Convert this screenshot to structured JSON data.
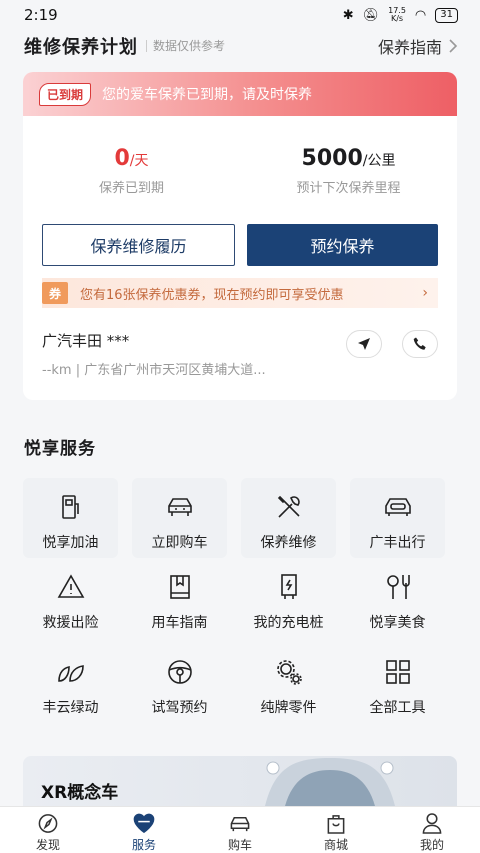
{
  "status_bar": {
    "time": "2:19",
    "speed_top": "17.5",
    "speed_bottom": "K/s",
    "battery": "31"
  },
  "header": {
    "title": "维修保养计划",
    "subtitle": "数据仅供参考",
    "guide_label": "保养指南"
  },
  "alert": {
    "badge": "已到期",
    "message": "您的爱车保养已到期，请及时保养"
  },
  "stats": [
    {
      "value": "0",
      "unit": "/天",
      "label": "保养已到期"
    },
    {
      "value": "5000",
      "unit": "/公里",
      "label": "预计下次保养里程"
    }
  ],
  "buttons": {
    "history": "保养维修履历",
    "book": "预约保养"
  },
  "coupon": {
    "tag": "券",
    "text": "您有16张保养优惠券，现在预约即可享受优惠",
    "chevron": "›"
  },
  "car": {
    "name": "广汽丰田 ***",
    "address": "--km | 广东省广州市天河区黄埔大道..."
  },
  "services": {
    "title": "悦享服务",
    "items": [
      {
        "label": "悦享加油",
        "icon": "fuel-icon"
      },
      {
        "label": "立即购车",
        "icon": "car-front-icon"
      },
      {
        "label": "保养维修",
        "icon": "tools-icon"
      },
      {
        "label": "广丰出行",
        "icon": "car-ticket-icon"
      },
      {
        "label": "救援出险",
        "icon": "warning-icon"
      },
      {
        "label": "用车指南",
        "icon": "book-icon"
      },
      {
        "label": "我的充电桩",
        "icon": "charger-icon"
      },
      {
        "label": "悦享美食",
        "icon": "cutlery-icon"
      },
      {
        "label": "丰云绿动",
        "icon": "leaf-icon"
      },
      {
        "label": "试驾预约",
        "icon": "steering-wheel-icon"
      },
      {
        "label": "纯牌零件",
        "icon": "gears-icon"
      },
      {
        "label": "全部工具",
        "icon": "grid-icon"
      }
    ]
  },
  "promo": {
    "title": "XR概念车"
  },
  "tabbar": {
    "active": "服务",
    "tabs": [
      {
        "label": "发现",
        "icon": "compass-icon"
      },
      {
        "label": "服务",
        "icon": "heart-icon"
      },
      {
        "label": "购车",
        "icon": "car-icon"
      },
      {
        "label": "商城",
        "icon": "shopping-bag-icon"
      },
      {
        "label": "我的",
        "icon": "person-icon"
      }
    ]
  },
  "colors": {
    "brand": "#1b4276",
    "alert_red": "#e33a3a",
    "coupon": "#f09a5c"
  }
}
